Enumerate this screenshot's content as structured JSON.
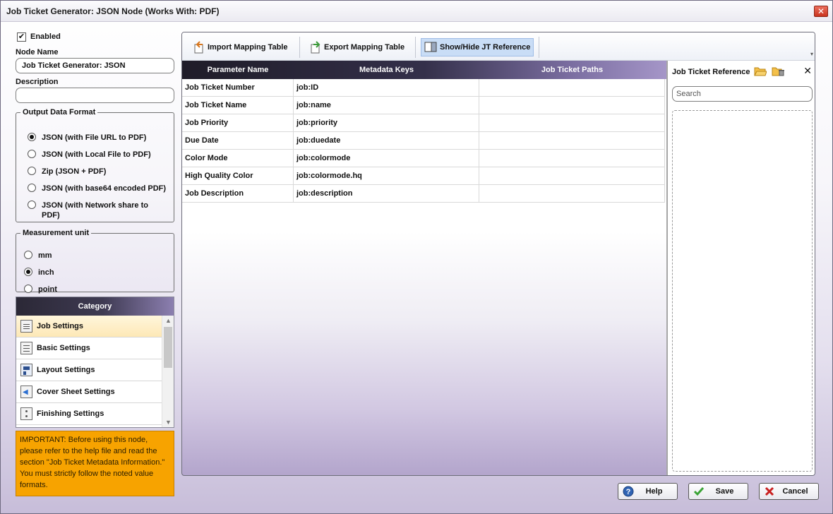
{
  "window": {
    "title": "Job Ticket Generator: JSON Node (Works With: PDF)",
    "close_glyph": "✕"
  },
  "left": {
    "enabled_label": "Enabled",
    "enabled_checked": true,
    "enabled_glyph": "✔",
    "node_name_label": "Node Name",
    "node_name_value": "Job Ticket Generator: JSON",
    "description_label": "Description",
    "description_value": "",
    "output_format": {
      "legend": "Output Data Format",
      "options": [
        {
          "label": "JSON (with File URL to PDF)",
          "selected": true
        },
        {
          "label": "JSON (with Local File to PDF)",
          "selected": false
        },
        {
          "label": "Zip (JSON + PDF)",
          "selected": false
        },
        {
          "label": "JSON (with base64 encoded PDF)",
          "selected": false
        },
        {
          "label": "JSON (with Network share to PDF)",
          "selected": false
        }
      ]
    },
    "measurement": {
      "legend": "Measurement unit",
      "options": [
        {
          "label": "mm",
          "selected": false
        },
        {
          "label": "inch",
          "selected": true
        },
        {
          "label": "point",
          "selected": false
        }
      ]
    },
    "category": {
      "header": "Category",
      "items": [
        {
          "label": "Job Settings",
          "icon": "document-icon",
          "selected": true
        },
        {
          "label": "Basic Settings",
          "icon": "list-icon",
          "selected": false
        },
        {
          "label": "Layout Settings",
          "icon": "layout-icon",
          "selected": false
        },
        {
          "label": "Cover Sheet Settings",
          "icon": "cover-sheet-icon",
          "selected": false
        },
        {
          "label": "Finishing Settings",
          "icon": "finishing-icon",
          "selected": false
        }
      ],
      "scroll_up_glyph": "▲",
      "scroll_down_glyph": "▼"
    },
    "important_note": "IMPORTANT: Before using this node, please refer to the help file and read the section \"Job Ticket Metadata Information.\" You must strictly follow the noted value formats."
  },
  "toolbar": {
    "import_label": "Import Mapping Table",
    "export_label": "Export Mapping Table",
    "showhide_label": "Show/Hide JT Reference",
    "more_glyph": "▾"
  },
  "grid": {
    "headers": [
      "Parameter Name",
      "Metadata Keys",
      "Job Ticket Paths"
    ],
    "rows": [
      [
        "Job Ticket Number",
        "job:ID",
        ""
      ],
      [
        "Job Ticket Name",
        "job:name",
        ""
      ],
      [
        "Job Priority",
        "job:priority",
        ""
      ],
      [
        "Due Date",
        "job:duedate",
        ""
      ],
      [
        "Color Mode",
        "job:colormode",
        ""
      ],
      [
        "High Quality Color",
        "job:colormode.hq",
        ""
      ],
      [
        "Job Description",
        "job:description",
        ""
      ]
    ]
  },
  "reference": {
    "title": "Job Ticket Reference",
    "search_placeholder": "Search",
    "close_glyph": "✕"
  },
  "buttons": {
    "help": "Help",
    "save": "Save",
    "cancel": "Cancel"
  },
  "colors": {
    "accent_dark": "#2b2836",
    "accent_purple": "#8c7fb0",
    "important_bg": "#f7a300",
    "selected_item": "#fde8b6",
    "toggle_active": "#c9ddf6",
    "save_check": "#3aa335",
    "cancel_x": "#c91f1f",
    "help_blue": "#2f63b3"
  }
}
